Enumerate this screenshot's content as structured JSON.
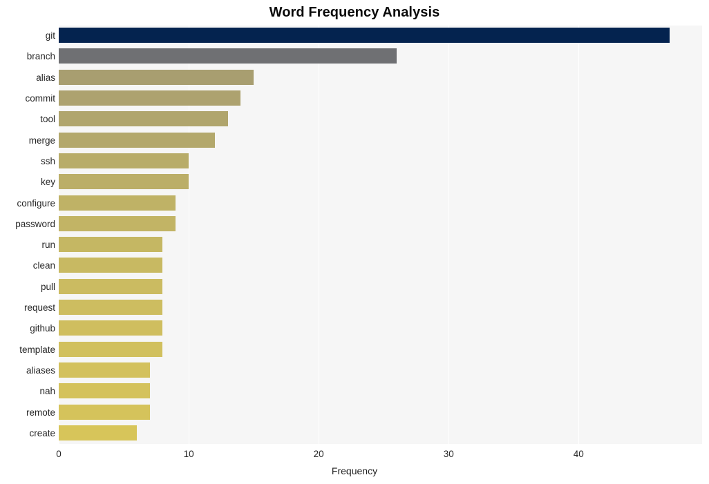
{
  "chart_data": {
    "type": "bar",
    "orientation": "horizontal",
    "title": "Word Frequency Analysis",
    "xlabel": "Frequency",
    "ylabel": "",
    "categories": [
      "git",
      "branch",
      "alias",
      "commit",
      "tool",
      "merge",
      "ssh",
      "key",
      "configure",
      "password",
      "run",
      "clean",
      "pull",
      "request",
      "github",
      "template",
      "aliases",
      "nah",
      "remote",
      "create"
    ],
    "values": [
      47,
      26,
      15,
      14,
      13,
      12,
      10,
      10,
      9,
      9,
      8,
      8,
      8,
      8,
      8,
      8,
      7,
      7,
      7,
      6
    ],
    "bar_colors": [
      "#04234f",
      "#6f7073",
      "#a89e70",
      "#ad a26f",
      "#b0a56d",
      "#b3a86c",
      "#b8ac69",
      "#bbae68",
      "#bfb266",
      "#c2b465",
      "#c5b763",
      "#c8b962",
      "#cbbb61",
      "#cdbd60",
      "#cfbe5f",
      "#d1c05e",
      "#d3c15d",
      "#d4c25c",
      "#d5c35b",
      "#d7c55a"
    ],
    "xlim": [
      0,
      49.5
    ],
    "xticks": [
      0,
      10,
      20,
      30,
      40
    ],
    "xticklabels": [
      "0",
      "10",
      "20",
      "30",
      "40"
    ],
    "grid": true,
    "grid_color": "#ffffff",
    "plot_background": "#f6f6f6",
    "figure_background": "#ffffff",
    "legend": null
  }
}
